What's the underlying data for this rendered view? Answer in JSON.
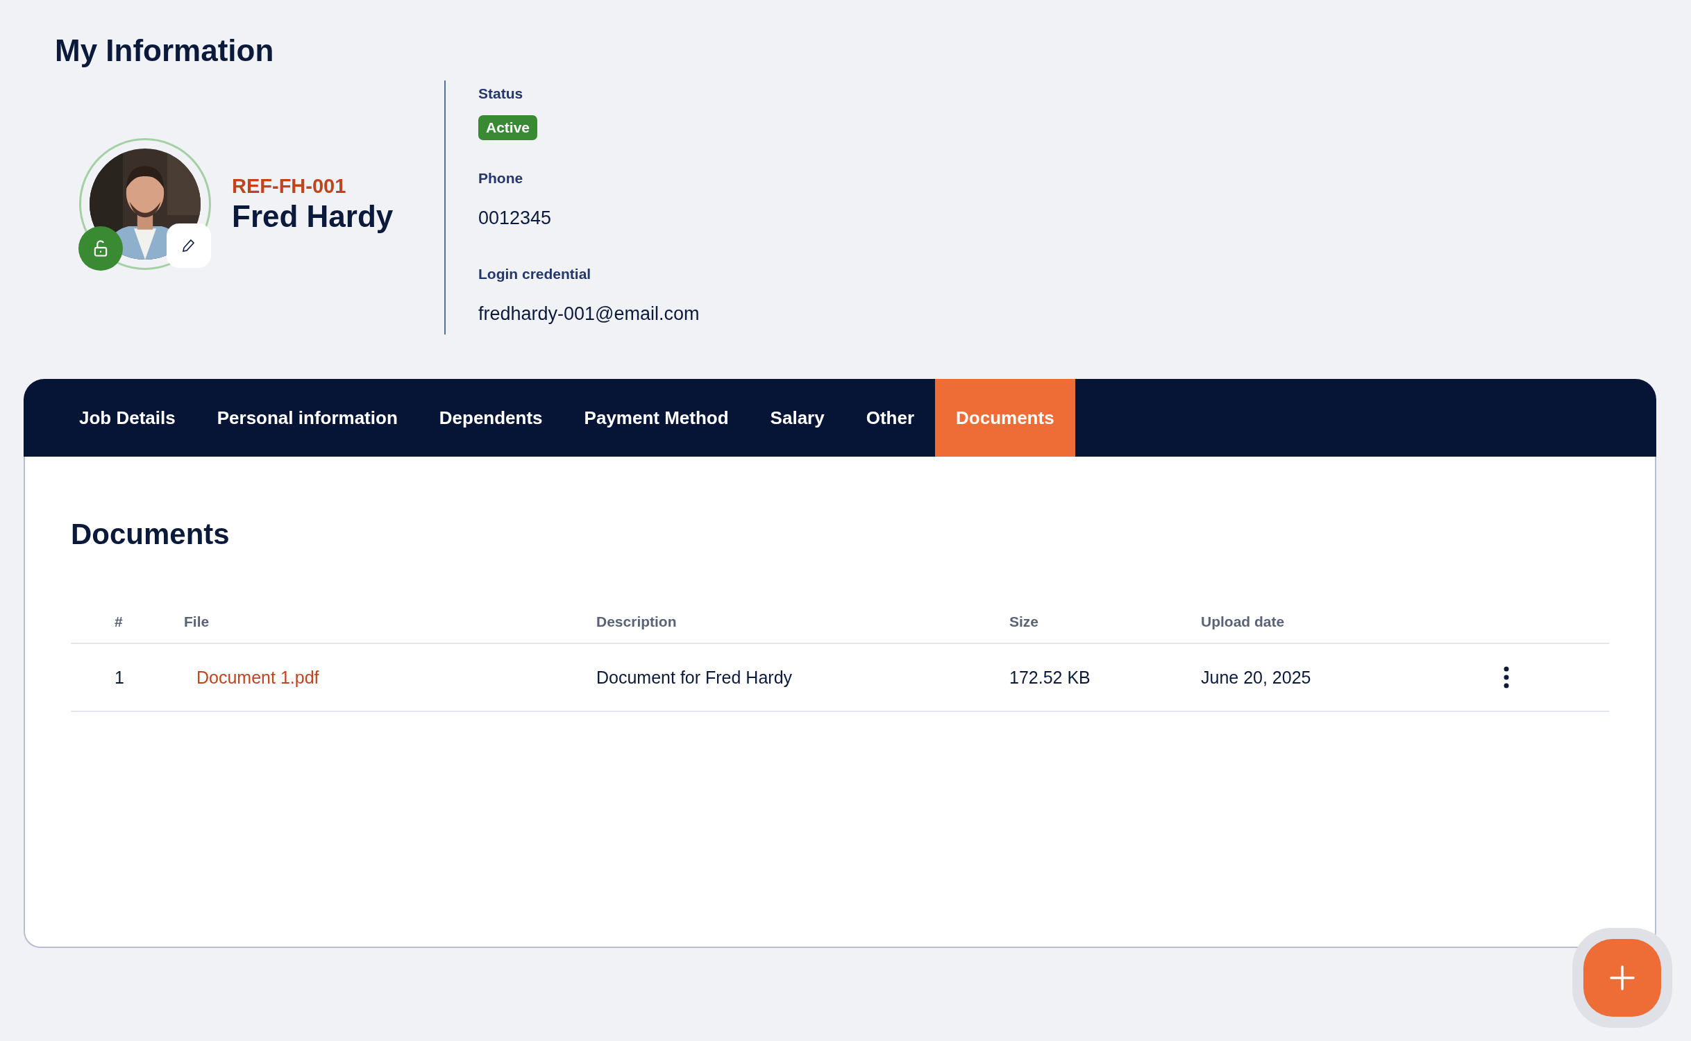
{
  "page": {
    "title": "My Information"
  },
  "profile": {
    "reference": "REF-FH-001",
    "name": "Fred Hardy"
  },
  "details": [
    {
      "label": "Status",
      "kind": "badge",
      "value": "Active"
    },
    {
      "label": "Phone",
      "kind": "text",
      "value": "0012345"
    },
    {
      "label": "Login credential",
      "kind": "text",
      "value": "fredhardy-001@email.com"
    }
  ],
  "tabs": [
    {
      "label": "Job Details",
      "selected": false
    },
    {
      "label": "Personal information",
      "selected": false
    },
    {
      "label": "Dependents",
      "selected": false
    },
    {
      "label": "Payment Method",
      "selected": false
    },
    {
      "label": "Salary",
      "selected": false
    },
    {
      "label": "Other",
      "selected": false
    },
    {
      "label": "Documents",
      "selected": true
    }
  ],
  "documents": {
    "heading": "Documents",
    "columns": [
      "#",
      "File",
      "Description",
      "Size",
      "Upload date"
    ],
    "rows": [
      {
        "cells": [
          "1",
          "Document 1.pdf",
          "Document for Fred Hardy",
          "172.52 KB",
          "June 20, 2025"
        ]
      }
    ]
  }
}
